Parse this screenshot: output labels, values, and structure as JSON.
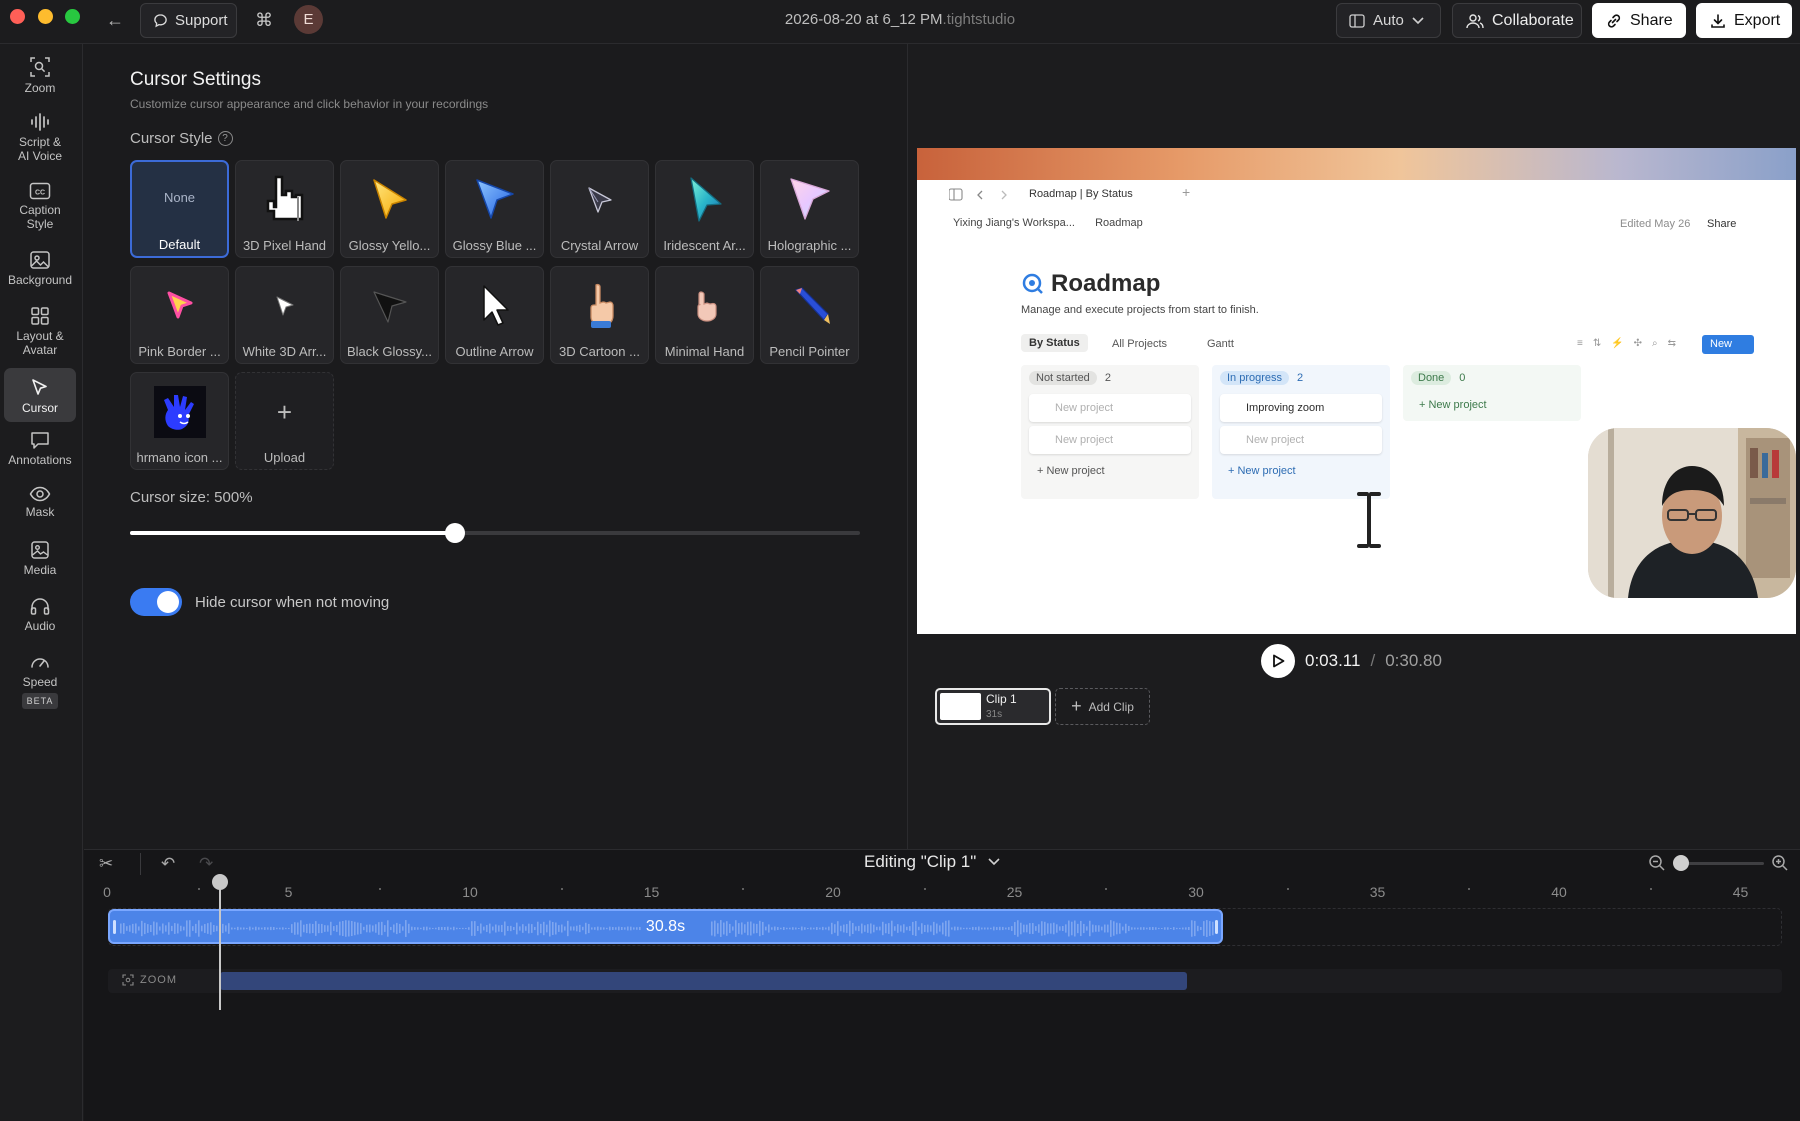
{
  "titlebar": {
    "support_label": "Support",
    "avatar_initial": "E",
    "document_title": "2026-08-20 at 6_12 PM",
    "document_ext": ".tightstudio",
    "auto_label": "Auto",
    "collaborate_label": "Collaborate",
    "share_label": "Share",
    "export_label": "Export"
  },
  "sidebar": {
    "items": [
      {
        "label": "Zoom",
        "icon": "zoom-icon"
      },
      {
        "label": "Script & AI Voice",
        "icon": "waveform-icon"
      },
      {
        "label": "Caption Style",
        "icon": "captions-icon"
      },
      {
        "label": "Background",
        "icon": "image-icon"
      },
      {
        "label": "Layout & Avatar",
        "icon": "layout-grid-icon"
      },
      {
        "label": "Cursor",
        "icon": "cursor-icon",
        "active": true
      },
      {
        "label": "Annotations",
        "icon": "comment-icon"
      },
      {
        "label": "Mask",
        "icon": "eye-icon"
      },
      {
        "label": "Media",
        "icon": "media-icon"
      },
      {
        "label": "Audio",
        "icon": "headphones-icon"
      },
      {
        "label": "Speed",
        "icon": "gauge-icon",
        "badge": "BETA"
      }
    ]
  },
  "settings": {
    "title": "Cursor Settings",
    "subtitle": "Customize cursor appearance and click behavior in your recordings",
    "style_label": "Cursor Style",
    "none_text": "None",
    "cursors": [
      {
        "label": "Default",
        "selected": true
      },
      {
        "label": "3D Pixel Hand"
      },
      {
        "label": "Glossy Yello..."
      },
      {
        "label": "Glossy Blue ..."
      },
      {
        "label": "Crystal Arrow"
      },
      {
        "label": "Iridescent Ar..."
      },
      {
        "label": "Holographic ..."
      },
      {
        "label": "Pink Border ..."
      },
      {
        "label": "White 3D Arr..."
      },
      {
        "label": "Black Glossy..."
      },
      {
        "label": "Outline Arrow"
      },
      {
        "label": "3D Cartoon ..."
      },
      {
        "label": "Minimal Hand"
      },
      {
        "label": "Pencil Pointer"
      },
      {
        "label": "hrmano icon ..."
      },
      {
        "label": "Upload"
      }
    ],
    "size_label": "Cursor size: 500%",
    "size_fraction": 0.445,
    "hide_cursor_label": "Hide cursor when not moving",
    "hide_cursor_enabled": true
  },
  "preview": {
    "tab_title": "Roadmap | By Status",
    "workspace_crumb": "Yixing Jiang's Workspa...",
    "page_crumb": "Roadmap",
    "edited": "Edited May 26",
    "share": "Share",
    "page_title": "Roadmap",
    "page_desc": "Manage and execute projects from start to finish.",
    "views": [
      "By Status",
      "All Projects",
      "Gantt"
    ],
    "new_button": "New",
    "columns": [
      {
        "status": "Not started",
        "count": "2",
        "cards": [
          "New project",
          "New project"
        ],
        "add": "New project"
      },
      {
        "status": "In progress",
        "count": "2",
        "cards": [
          "Improving zoom",
          "New project"
        ],
        "add": "New project"
      },
      {
        "status": "Done",
        "count": "0",
        "cards": [],
        "add": "New project"
      }
    ]
  },
  "player": {
    "current_time": "0:03.11",
    "separator": "/",
    "total_time": "0:30.80",
    "clip_name": "Clip 1",
    "clip_length": "31s",
    "add_clip_label": "Add Clip"
  },
  "timeline": {
    "editing_label": "Editing \"Clip 1\"",
    "ticks": [
      "0",
      "5",
      "10",
      "15",
      "20",
      "25",
      "30",
      "35",
      "40",
      "45"
    ],
    "audio_clip_length": "30.8s",
    "audio_seconds": 30.8,
    "playhead_seconds": 3.11,
    "zoom_track_label": "ZOOM",
    "zoom_segment_seconds": [
      3.11,
      30.8
    ]
  }
}
